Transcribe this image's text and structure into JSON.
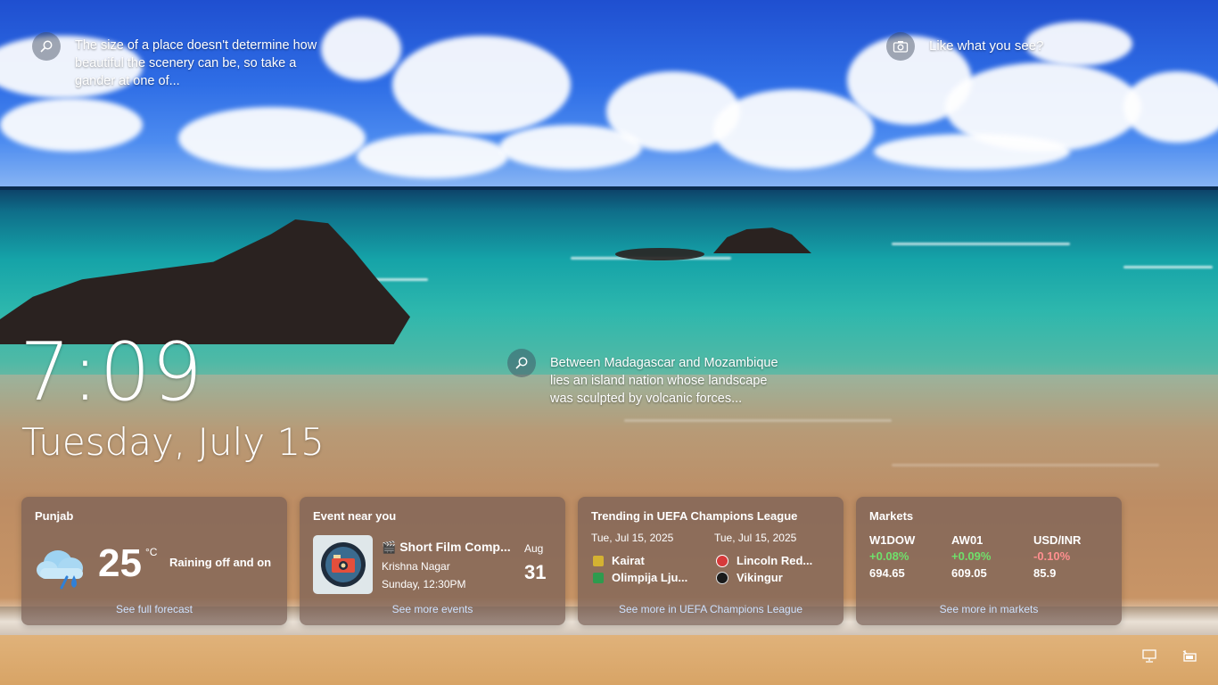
{
  "spotlight": {
    "tip1": "The size of a place doesn't determine how beautiful the scenery can be, so take a gander at one of...",
    "like": "Like what you see?",
    "tip2": "Between Madagascar and Mozambique lies an island nation whose landscape was sculpted by volcanic forces..."
  },
  "clock": {
    "time": "7:09",
    "date": "Tuesday, July 15"
  },
  "weather": {
    "location": "Punjab",
    "temperature": "25",
    "unit": "°C",
    "condition": "Raining off and on",
    "link": "See full forecast",
    "icon": "rain-cloud-icon"
  },
  "event": {
    "title": "Event near you",
    "name": "Short Film Comp...",
    "location": "Krishna Nagar",
    "time": "Sunday, 12:30PM",
    "month": "Aug",
    "day": "31",
    "link": "See more events"
  },
  "sports": {
    "title": "Trending in UEFA Champions League",
    "matches": [
      {
        "date": "Tue, Jul 15, 2025",
        "team1": "Kairat",
        "team2": "Olimpija Lju..."
      },
      {
        "date": "Tue, Jul 15, 2025",
        "team1": "Lincoln Red...",
        "team2": "Vikingur"
      }
    ],
    "link": "See more in UEFA Champions League"
  },
  "markets": {
    "title": "Markets",
    "items": [
      {
        "symbol": "W1DOW",
        "change": "+0.08%",
        "value": "694.65",
        "direction": "up"
      },
      {
        "symbol": "AW01",
        "change": "+0.09%",
        "value": "609.05",
        "direction": "up"
      },
      {
        "symbol": "USD/INR",
        "change": "-0.10%",
        "value": "85.9",
        "direction": "down"
      }
    ],
    "link": "See more in markets"
  },
  "colors": {
    "up": "#6fe06b",
    "down": "#ff8f8f",
    "link": "#cfe2ff"
  },
  "system_icons": [
    "network-icon",
    "battery-icon"
  ]
}
